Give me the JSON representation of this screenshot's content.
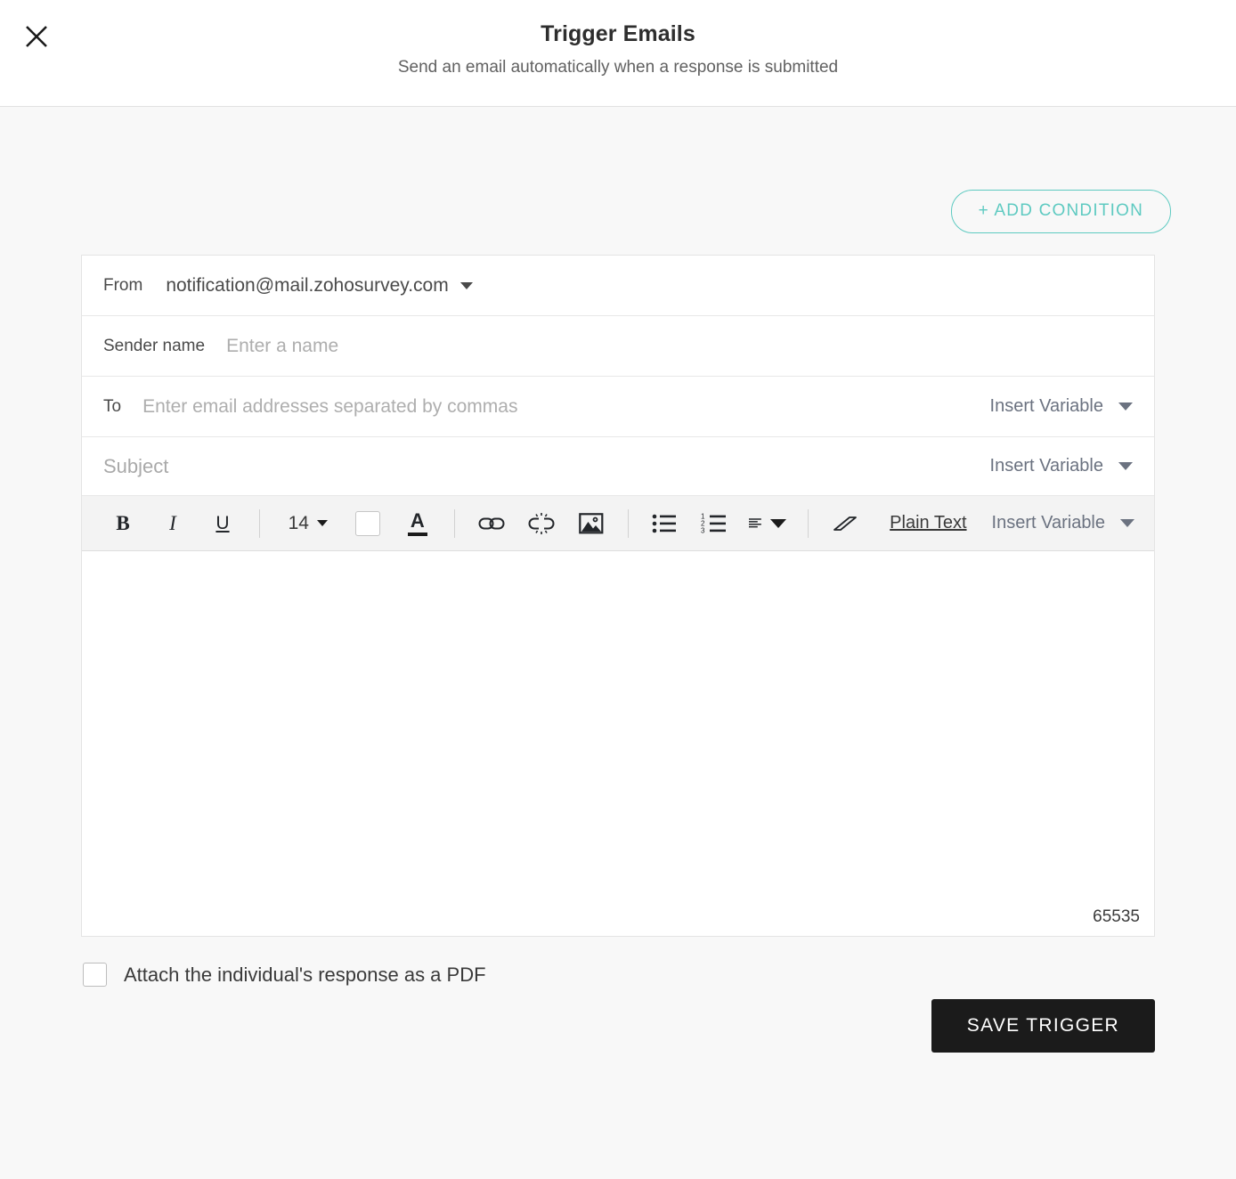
{
  "header": {
    "title": "Trigger Emails",
    "subtitle": "Send an email automatically when a response is submitted",
    "close_icon": "close-icon"
  },
  "actions": {
    "add_condition": "+ ADD CONDITION"
  },
  "form": {
    "from": {
      "label": "From",
      "value": "notification@mail.zohosurvey.com"
    },
    "sender_name": {
      "label": "Sender name",
      "placeholder": "Enter a name",
      "value": ""
    },
    "to": {
      "label": "To",
      "placeholder": "Enter email addresses separated by commas",
      "value": "",
      "insert_variable": "Insert Variable"
    },
    "subject": {
      "placeholder": "Subject",
      "value": "",
      "insert_variable": "Insert Variable"
    }
  },
  "toolbar": {
    "bold": "B",
    "italic": "I",
    "underline": "U",
    "font_size": "14",
    "highlight_color": "#ffffff",
    "font_color_letter": "A",
    "plain_text": "Plain Text",
    "insert_variable": "Insert Variable",
    "icons": {
      "link": "link-icon",
      "unlink": "unlink-icon",
      "image": "image-icon",
      "bullet_list": "bullet-list-icon",
      "numbered_list": "numbered-list-icon",
      "align": "align-left-icon",
      "clear_format": "eraser-icon"
    }
  },
  "editor": {
    "content": "",
    "char_count": "65535"
  },
  "footer": {
    "attach_pdf_label": "Attach the individual's response as a PDF",
    "attach_pdf_checked": false,
    "save_label": "SAVE TRIGGER"
  },
  "colors": {
    "accent_teal": "#5ecac1",
    "page_background": "#f8f8f8",
    "card_background": "#ffffff",
    "toolbar_background": "#f3f3f3",
    "save_button_background": "#1b1b1b"
  }
}
